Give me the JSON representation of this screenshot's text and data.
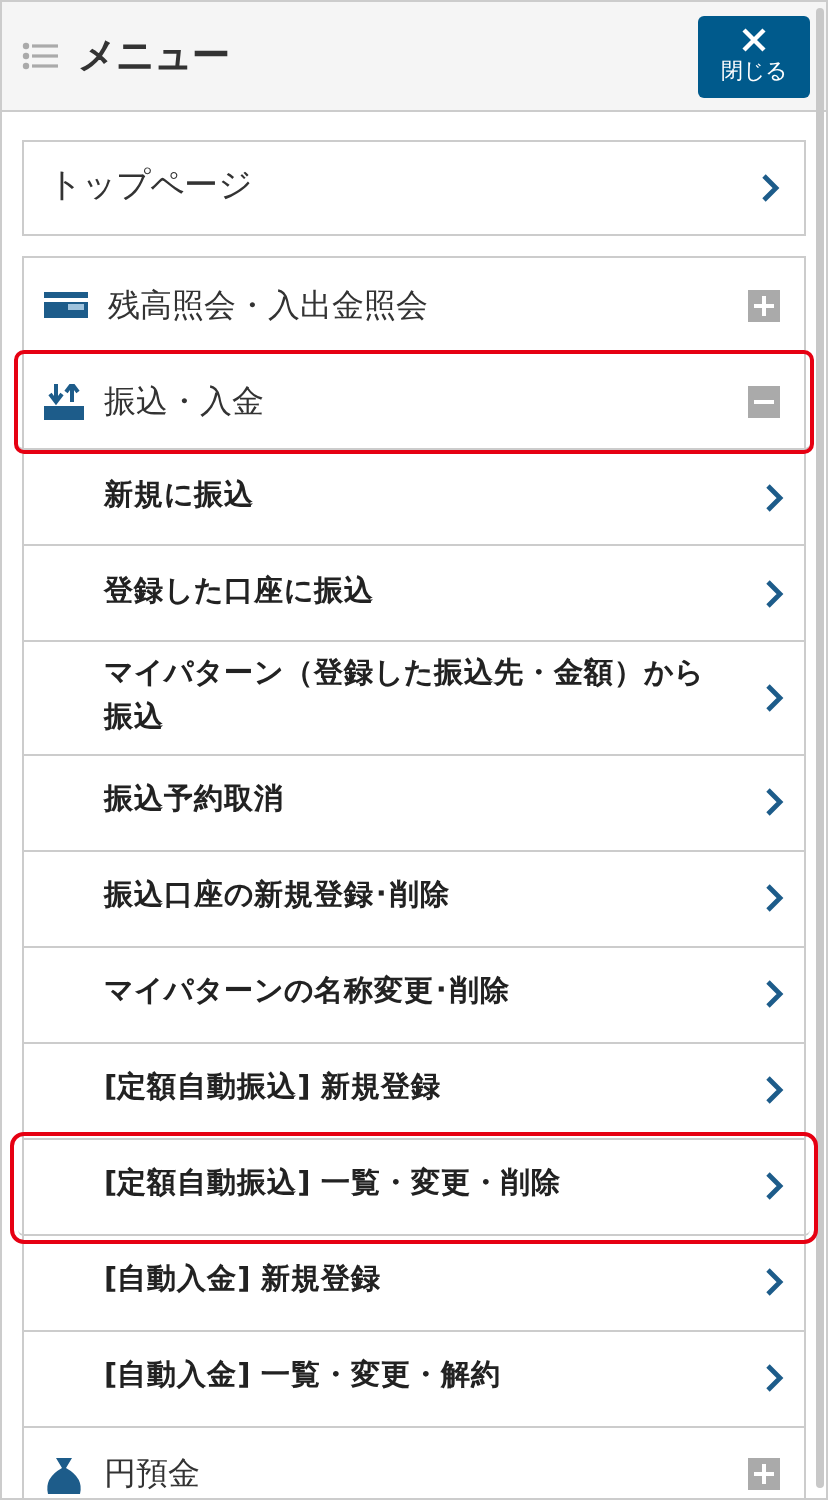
{
  "header": {
    "title": "メニュー",
    "close_button": "閉じる"
  },
  "top_link": {
    "label": "トップページ"
  },
  "sections": [
    {
      "kind": "card",
      "label": "残高照会・入出金照会",
      "expanded": false,
      "highlighted": false
    },
    {
      "kind": "transfer",
      "label": "振込・入金",
      "expanded": true,
      "highlighted": true,
      "children": [
        {
          "label": "新規に振込",
          "highlighted": false
        },
        {
          "label": "登録した口座に振込",
          "highlighted": false
        },
        {
          "label": "マイパターン（登録した振込先・金額）から振込",
          "highlighted": false
        },
        {
          "label": "振込予約取消",
          "highlighted": false
        },
        {
          "label": "振込口座の新規登録･削除",
          "highlighted": false
        },
        {
          "label": "マイパターンの名称変更･削除",
          "highlighted": false
        },
        {
          "label": "[定額自動振込] 新規登録",
          "highlighted": false
        },
        {
          "label": "[定額自動振込] 一覧・変更・削除",
          "highlighted": true
        },
        {
          "label": "[自動入金] 新規登録",
          "highlighted": false
        },
        {
          "label": "[自動入金] 一覧・変更・解約",
          "highlighted": false
        }
      ]
    },
    {
      "kind": "moneybag",
      "label": "円預金",
      "expanded": false,
      "highlighted": false
    }
  ]
}
